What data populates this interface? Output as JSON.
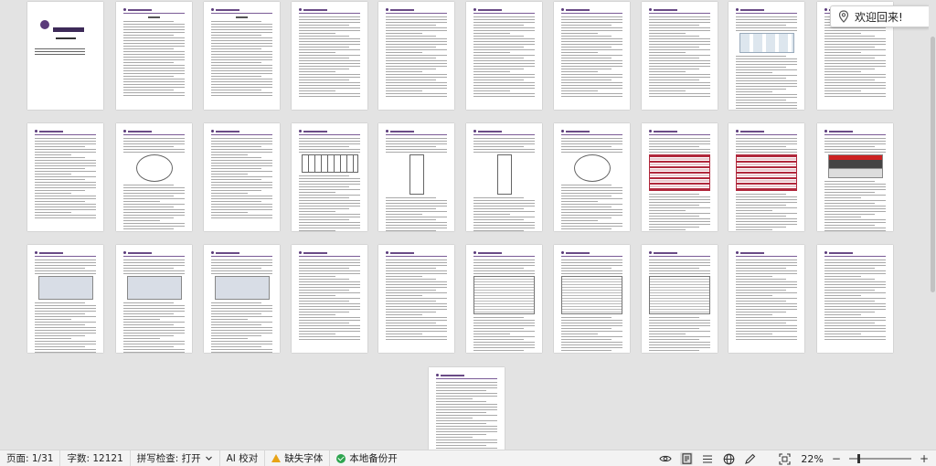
{
  "toast": {
    "message": "欢迎回来!",
    "icon": "location-pin-icon"
  },
  "status": {
    "page": "页面: 1/31",
    "words": "字数: 12121",
    "spell": "拼写检查: 打开",
    "ai_check": "AI 校对",
    "missing_font": "缺失字体",
    "backup": "本地备份开",
    "zoom": "22%",
    "zoom_minus": "−",
    "zoom_plus": "+",
    "zoom_level": 0.22
  },
  "colors": {
    "accent": "#7a5a96",
    "table_red": "#b0273b",
    "ok_green": "#2ea44f",
    "warn_amber": "#e8a317"
  },
  "document": {
    "total_pages": 31
  }
}
